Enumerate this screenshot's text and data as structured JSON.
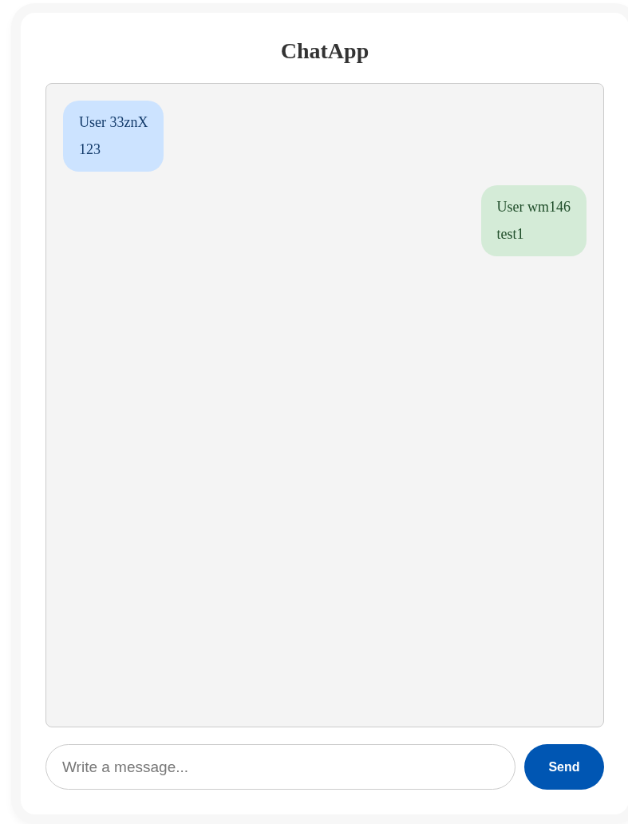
{
  "title": "ChatApp",
  "messages": [
    {
      "kind": "received",
      "sender": "User 33znX",
      "text": "123"
    },
    {
      "kind": "sent",
      "sender": "User wm146",
      "text": "test1"
    }
  ],
  "composer": {
    "placeholder": "Write a message...",
    "send_label": "Send"
  }
}
